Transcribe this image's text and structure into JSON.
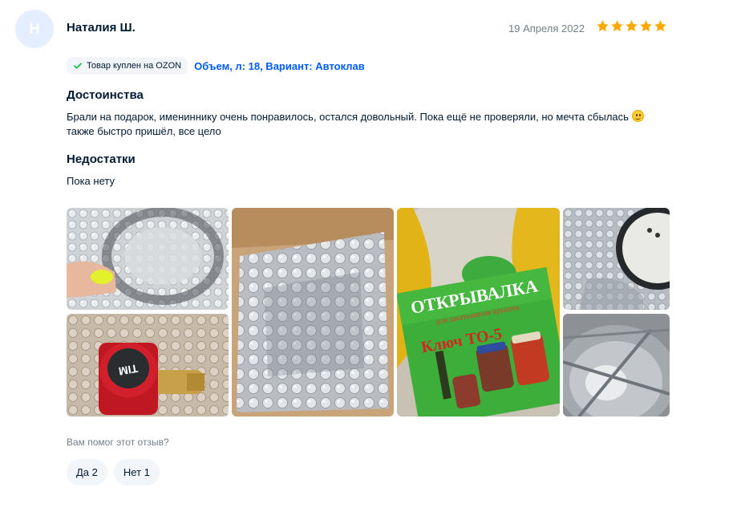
{
  "review": {
    "avatar_initial": "Н",
    "author": "Наталия Ш.",
    "date": "19 Апреля 2022",
    "rating": 5,
    "rating_max": 5,
    "purchase_badge": "Товар куплен на OZON",
    "variant": "Объем, л: 18, Вариант: Автоклав",
    "pros_title": "Достоинства",
    "pros_line1": "Брали на подарок, имениннику очень понравилось, остался довольный. Пока ещё не проверяли, но мечта сбылась ",
    "pros_line2": "также быстро пришёл, все цело",
    "cons_title": "Недостатки",
    "cons_text": "Пока нету",
    "photo_label_big": "ОТКРЫВАЛКА",
    "photo_label_sub": "для закатывания крышек",
    "photo_label_key": "Ключ ТО-5",
    "photo_valve_text": "TIM",
    "helpful_question": "Вам помог этот отзыв?",
    "yes_label": "Да 2",
    "no_label": "Нет 1"
  },
  "colors": {
    "accent": "#005bff",
    "star": "#ffa800",
    "muted": "#707f8d",
    "text": "#001a34",
    "badge_bg": "#f2f5f9",
    "check": "#10c44c"
  }
}
